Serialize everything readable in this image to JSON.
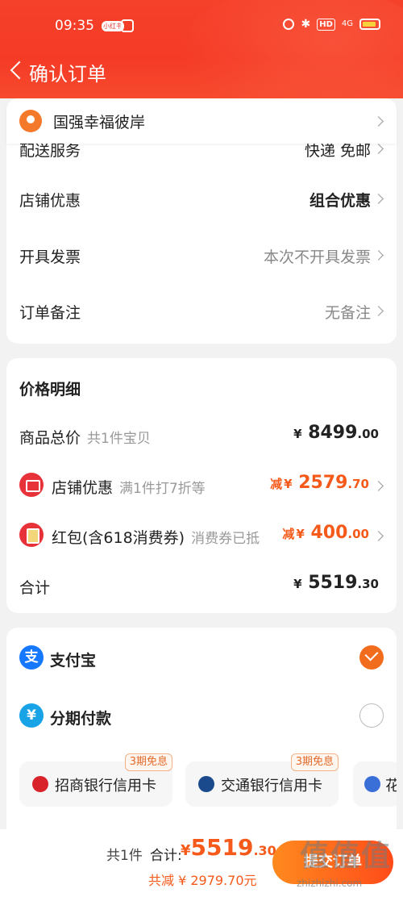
{
  "status_bar": {
    "time": "09:35",
    "app_badge_1": "小红书",
    "hd_label": "HD",
    "signal_label": "4G"
  },
  "nav": {
    "title": "确认订单"
  },
  "address": {
    "text": "国强幸福彼岸"
  },
  "order_options": {
    "partial_row": {
      "label": "配送服务",
      "value": "快递 免邮"
    },
    "rows": [
      {
        "label": "店铺优惠",
        "value": "组合优惠"
      },
      {
        "label": "开具发票",
        "value": "本次不开具发票"
      },
      {
        "label": "订单备注",
        "value": "无备注"
      }
    ]
  },
  "price_details": {
    "title": "价格明细",
    "goods_total": {
      "label": "商品总价",
      "sub": "共1件宝贝",
      "yen": "¥",
      "int": "8499",
      "dec": ".00"
    },
    "shop_discount": {
      "label": "店铺优惠",
      "sub": "满1件打7折等",
      "minus": "减",
      "yen": "¥",
      "int": "2579",
      "dec": ".70"
    },
    "red_packet": {
      "label": "红包(含618消费券)",
      "sub": "消费券已抵",
      "minus": "减",
      "yen": "¥",
      "int": "400",
      "dec": ".00"
    },
    "total": {
      "label": "合计",
      "yen": "¥",
      "int": "5519",
      "dec": ".30"
    }
  },
  "payment": {
    "alipay": {
      "icon_text": "支",
      "label": "支付宝",
      "selected": true
    },
    "installment": {
      "icon_text": "¥",
      "label": "分期付款",
      "selected": false
    },
    "banks": [
      {
        "name": "招商银行信用卡",
        "badge": "3期免息"
      },
      {
        "name": "交通银行信用卡",
        "badge": "3期免息"
      },
      {
        "name": "花"
      }
    ]
  },
  "footer": {
    "count": "共1件",
    "total_label": "合计:",
    "total_yen": "¥",
    "total_int": "5519",
    "total_dec": ".30",
    "saved": "共减 ¥ 2979.70元",
    "submit_label": "提交订单"
  },
  "watermark": {
    "text": "值值值",
    "url": "zhizhizhi.com"
  },
  "colors": {
    "header_red": "#f5402a",
    "accent_orange": "#f55a1a",
    "alipay_blue": "#1677ff"
  }
}
